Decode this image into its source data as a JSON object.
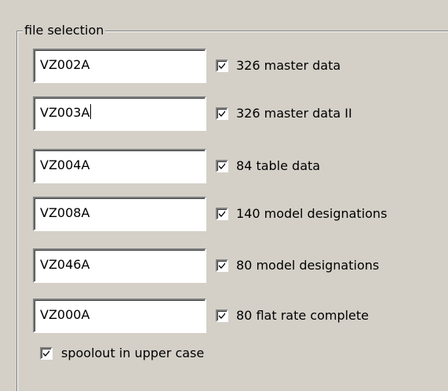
{
  "group": {
    "title": "file selection"
  },
  "files": [
    {
      "value": "VZ002A",
      "label": "326 master data",
      "checked": true
    },
    {
      "value": "VZ003A",
      "label": "326 master data II",
      "checked": true,
      "focused": true
    },
    {
      "value": "VZ004A",
      "label": "84 table data",
      "checked": true
    },
    {
      "value": "VZ008A",
      "label": "140 model designations",
      "checked": true
    },
    {
      "value": "VZ046A",
      "label": "80 model designations",
      "checked": true
    },
    {
      "value": "VZ000A",
      "label": "80 flat rate complete",
      "checked": true
    }
  ],
  "spoolout": {
    "label": "spoolout in upper case",
    "checked": true
  },
  "icons": {
    "checkbox_mark": "check-icon"
  }
}
